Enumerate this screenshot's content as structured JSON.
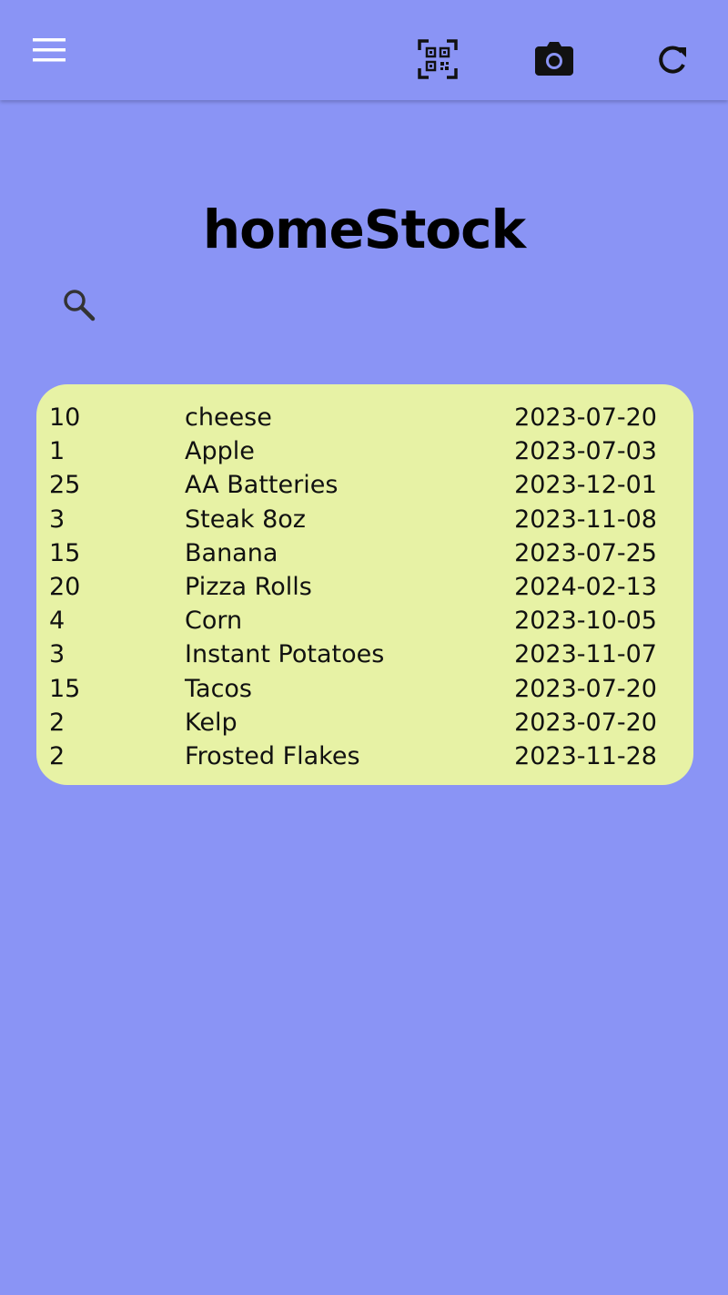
{
  "app": {
    "title": "homeStock",
    "colors": {
      "background": "#8a94f5",
      "card": "#e7f2a5",
      "text": "#111111"
    }
  },
  "toolbar": {
    "menu_icon": "hamburger-menu-icon",
    "qr_icon": "qr-scan-icon",
    "camera_icon": "camera-icon",
    "refresh_icon": "refresh-icon"
  },
  "search": {
    "icon": "search-icon"
  },
  "items": [
    {
      "qty": "10",
      "name": "cheese",
      "date": "2023-07-20"
    },
    {
      "qty": "1",
      "name": "Apple",
      "date": "2023-07-03"
    },
    {
      "qty": "25",
      "name": "AA Batteries",
      "date": "2023-12-01"
    },
    {
      "qty": "3",
      "name": "Steak 8oz",
      "date": "2023-11-08"
    },
    {
      "qty": "15",
      "name": "Banana",
      "date": "2023-07-25"
    },
    {
      "qty": "20",
      "name": "Pizza Rolls",
      "date": "2024-02-13"
    },
    {
      "qty": "4",
      "name": "Corn",
      "date": "2023-10-05"
    },
    {
      "qty": "3",
      "name": "Instant Potatoes",
      "date": "2023-11-07"
    },
    {
      "qty": "15",
      "name": "Tacos",
      "date": "2023-07-20"
    },
    {
      "qty": "2",
      "name": "Kelp",
      "date": "2023-07-20"
    },
    {
      "qty": "2",
      "name": "Frosted Flakes",
      "date": "2023-11-28"
    }
  ]
}
